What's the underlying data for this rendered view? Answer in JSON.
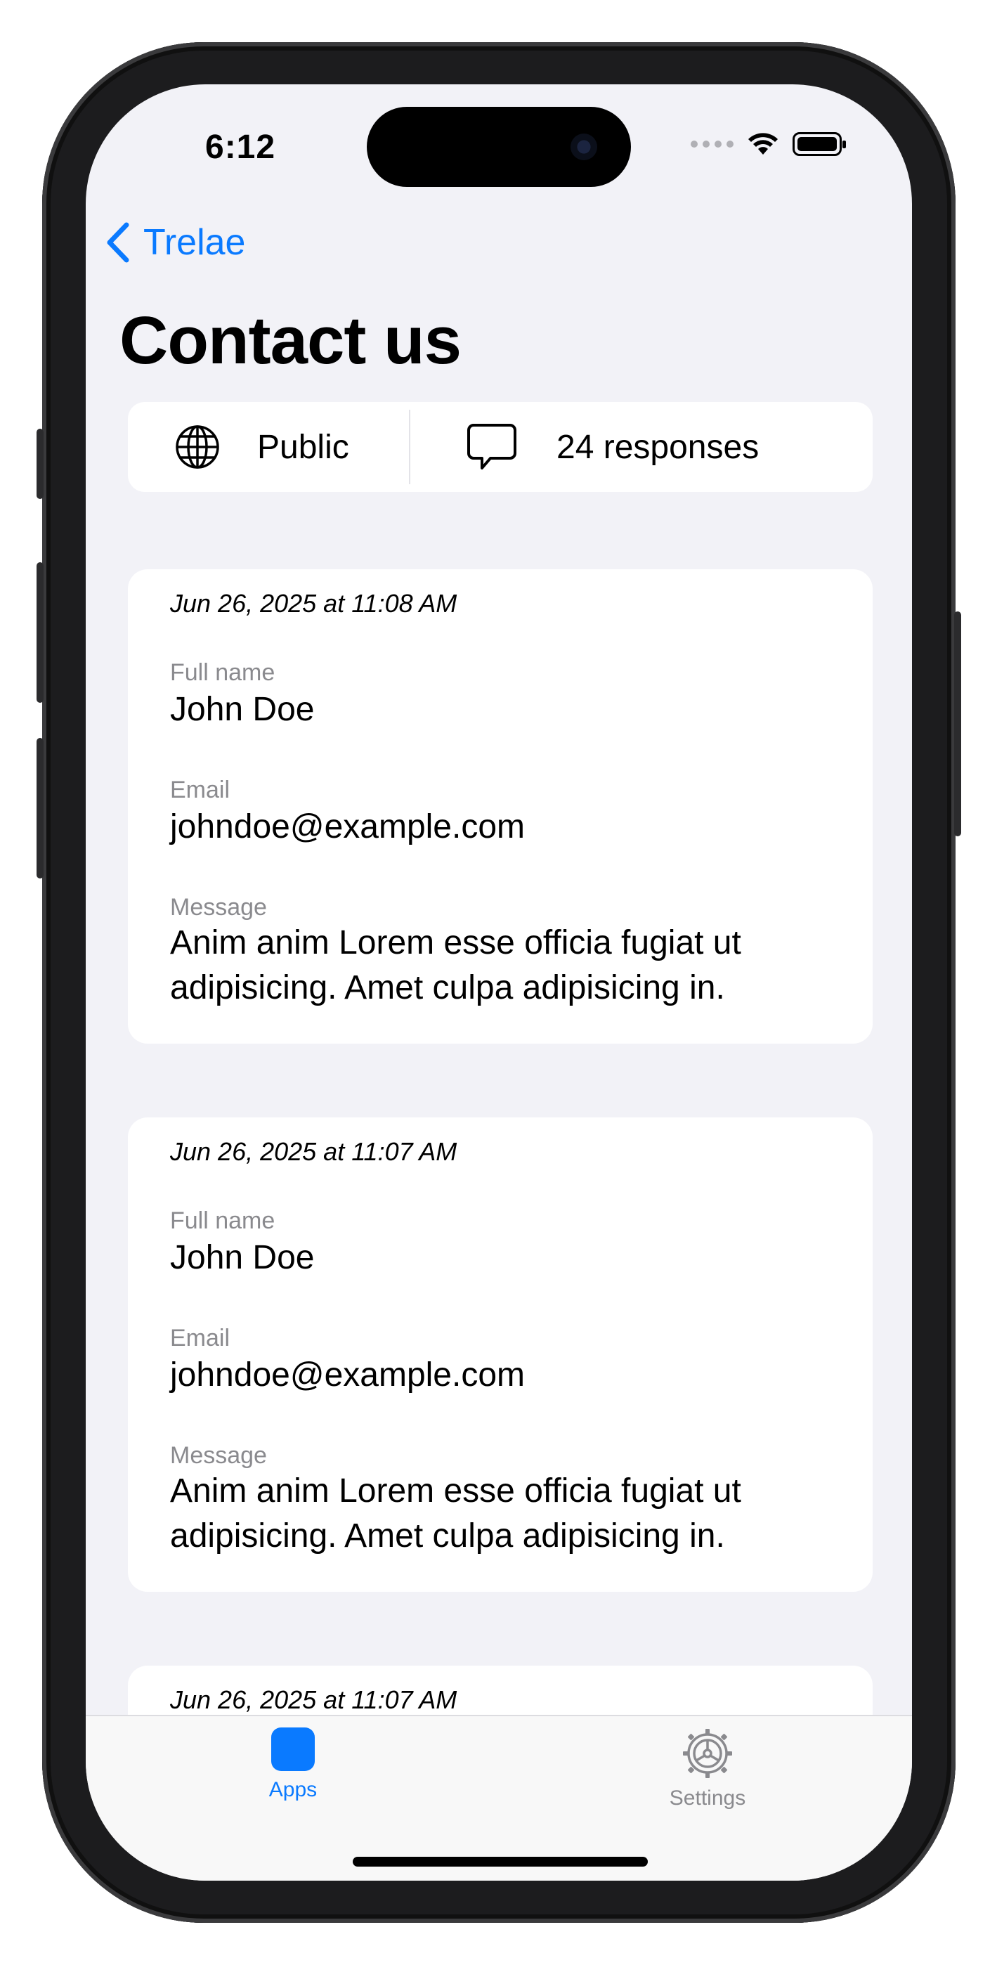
{
  "status_bar": {
    "time": "6:12"
  },
  "nav": {
    "back_label": "Trelae"
  },
  "page": {
    "title": "Contact us"
  },
  "info_bar": {
    "visibility": "Public",
    "responses": "24 responses"
  },
  "responses": [
    {
      "date": "Jun 26, 2025 at 11:08 AM",
      "full_name_label": "Full name",
      "full_name": "John Doe",
      "email_label": "Email",
      "email": "johndoe@example.com",
      "message_label": "Message",
      "message": "Anim anim Lorem esse officia fugiat ut adipisicing. Amet culpa adipisicing in."
    },
    {
      "date": "Jun 26, 2025 at 11:07 AM",
      "full_name_label": "Full name",
      "full_name": "John Doe",
      "email_label": "Email",
      "email": "johndoe@example.com",
      "message_label": "Message",
      "message": "Anim anim Lorem esse officia fugiat ut adipisicing. Amet culpa adipisicing in."
    },
    {
      "date": "Jun 26, 2025 at 11:07 AM"
    }
  ],
  "tabbar": {
    "tabs": [
      {
        "label": "Apps",
        "icon": "apps-icon",
        "active": true
      },
      {
        "label": "Settings",
        "icon": "gear-icon",
        "active": false
      }
    ]
  },
  "colors": {
    "accent": "#0a7aff",
    "inactive": "#8a8a8e",
    "background": "#f2f2f7"
  }
}
